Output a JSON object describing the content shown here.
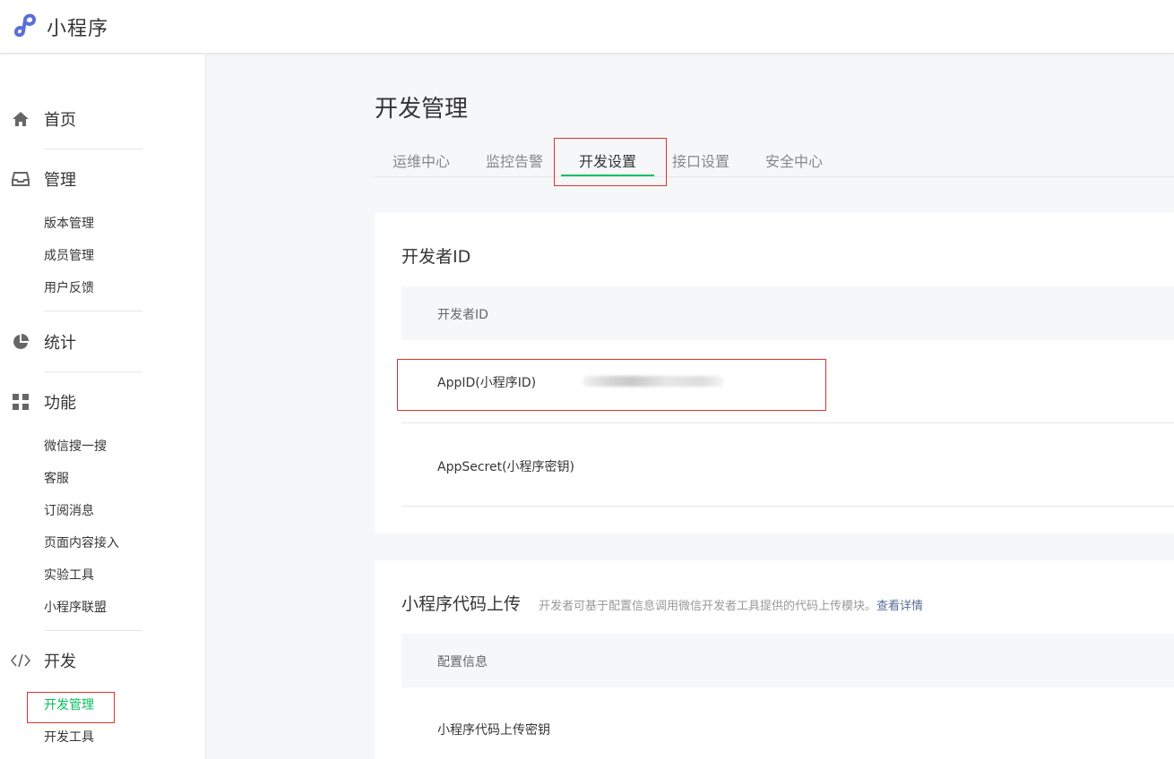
{
  "header": {
    "app_name": "小程序",
    "logo_icon": "miniprogram-logo-icon",
    "logo_color": "#5b6fd8"
  },
  "sidebar": {
    "groups": [
      {
        "label": "首页",
        "icon": "home-icon",
        "items": []
      },
      {
        "label": "管理",
        "icon": "inbox-icon",
        "items": [
          "版本管理",
          "成员管理",
          "用户反馈"
        ]
      },
      {
        "label": "统计",
        "icon": "pie-chart-icon",
        "items": []
      },
      {
        "label": "功能",
        "icon": "grid-icon",
        "items": [
          "微信搜一搜",
          "客服",
          "订阅消息",
          "页面内容接入",
          "实验工具",
          "小程序联盟"
        ]
      },
      {
        "label": "开发",
        "icon": "code-icon",
        "items": [
          "开发管理",
          "开发工具"
        ]
      }
    ],
    "active_item": "开发管理",
    "active_color": "#07c160"
  },
  "main": {
    "title": "开发管理",
    "tabs": [
      "运维中心",
      "监控告警",
      "开发设置",
      "接口设置",
      "安全中心"
    ],
    "active_tab": "开发设置",
    "developer_id_card": {
      "title": "开发者ID",
      "table_header": "开发者ID",
      "rows": [
        {
          "key": "AppID(小程序ID)"
        },
        {
          "key": "AppSecret(小程序密钥)"
        }
      ]
    },
    "upload_card": {
      "title": "小程序代码上传",
      "description": "开发者可基于配置信息调用微信开发者工具提供的代码上传模块。",
      "link": "查看详情",
      "table_header": "配置信息",
      "rows": [
        {
          "key": "小程序代码上传密钥"
        }
      ]
    }
  },
  "colors": {
    "highlight_box": "#e0312c",
    "link": "#576b95"
  }
}
